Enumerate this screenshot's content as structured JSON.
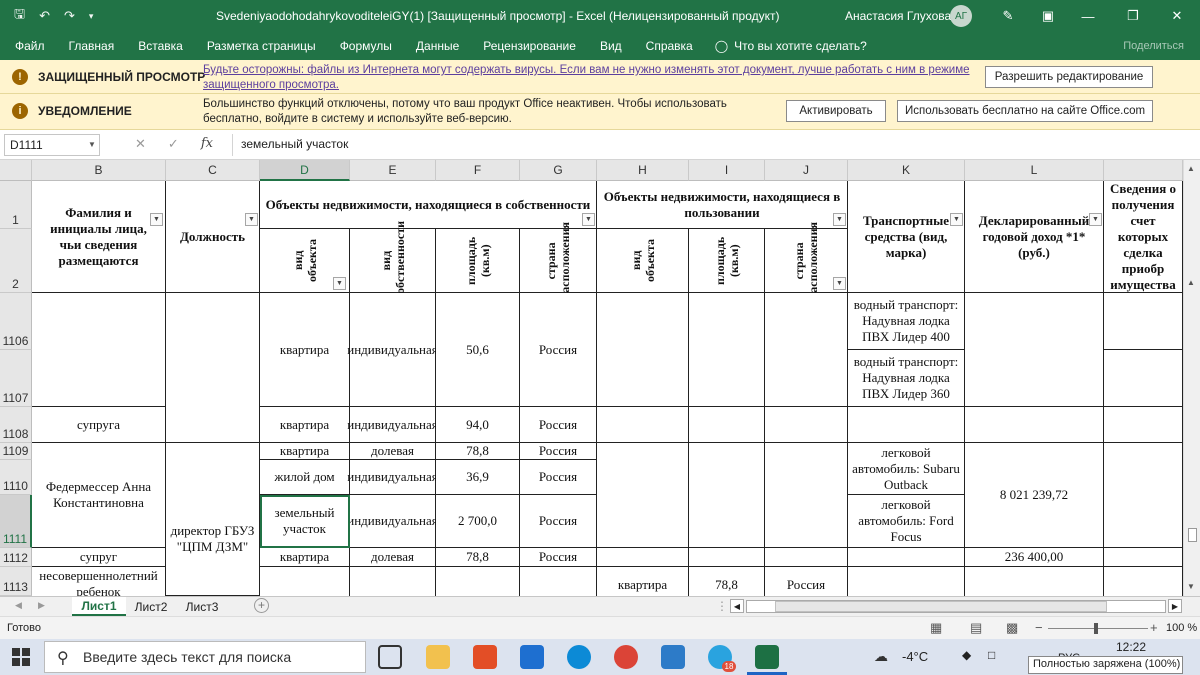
{
  "titlebar": {
    "doc_title": "SvedeniyaodohodahrykovoditeleiGY(1)  [Защищенный просмотр]  -  Excel (Нелицензированный продукт)",
    "user_name": "Анастасия Глухова",
    "avatar_initials": "АГ"
  },
  "ribbon": {
    "tabs": [
      "Файл",
      "Главная",
      "Вставка",
      "Разметка страницы",
      "Формулы",
      "Данные",
      "Рецензирование",
      "Вид",
      "Справка"
    ],
    "tell_me": "Что вы хотите сделать?",
    "share": "Поделиться"
  },
  "protected_bar": {
    "title": "ЗАЩИЩЕННЫЙ ПРОСМОТР",
    "text_line1": "Будьте осторожны: файлы из Интернета могут содержать вирусы. Если вам не нужно изменять этот документ, лучше работать с ним в режиме",
    "text_line2": "защищенного просмотра.",
    "button": "Разрешить редактирование"
  },
  "notice_bar": {
    "title": "УВЕДОМЛЕНИЕ",
    "text_line1": "Большинство функций отключены, потому что ваш продукт Office неактивен. Чтобы использовать",
    "text_line2": "бесплатно, войдите в систему и используйте веб-версию.",
    "button_activate": "Активировать",
    "button_online": "Использовать бесплатно на сайте Office.com"
  },
  "formula_bar": {
    "name_box": "D1111",
    "formula": "земельный участок"
  },
  "columns": [
    "B",
    "C",
    "D",
    "E",
    "F",
    "G",
    "H",
    "I",
    "J",
    "K",
    "L"
  ],
  "rows": [
    "1",
    "2",
    "1106",
    "1107",
    "1108",
    "1109",
    "1110",
    "1111",
    "1112",
    "1113"
  ],
  "header": {
    "fio": "Фамилия и инициалы лица, чьи сведения размещаются",
    "position": "Должность",
    "owned": "Объекты недвижимости, находящиеся в собственности",
    "used": "Объекты недвижимости, находящиеся в пользовании",
    "vehicles": "Транспортные средства (вид, марка)",
    "income": "Декларированный годовой доход *1* (руб.)",
    "sources": "Сведения о получения счет которых сделка приобр имущества",
    "obj_type": "вид объекта",
    "own_type": "вид собственности",
    "area": "площадь (кв.м)",
    "country": "страна расположения"
  },
  "cells": {
    "r1106_d": "квартира",
    "r1106_e": "индивидуальная",
    "r1106_f": "50,6",
    "r1106_g": "Россия",
    "r1106_k": "водный транспорт: Надувная лодка ПВХ Лидер 400",
    "r1107_k": "водный транспорт: Надувная лодка ПВХ Лидер 360",
    "r1108_b": "супруга",
    "r1108_d": "квартира",
    "r1108_e": "индивидуальная",
    "r1108_f": "94,0",
    "r1108_g": "Россия",
    "name_fed": "Федермессер Анна Константиновна",
    "position_fed": "директор ГБУЗ \"ЦПМ ДЗМ\"",
    "r1109_d": "квартира",
    "r1109_e": "долевая",
    "r1109_f": "78,8",
    "r1109_g": "Россия",
    "r1110_d": "жилой дом",
    "r1110_e": "индивидуальная",
    "r1110_f": "36,9",
    "r1110_g": "Россия",
    "r1111_d": "земельный участок",
    "r1111_e": "индивидуальная",
    "r1111_f": "2 700,0",
    "r1111_g": "Россия",
    "car1": "легковой автомобиль: Subaru Outback",
    "car2": "легковой автомобиль: Ford Focus",
    "income_fed": "8 021 239,72",
    "r1112_b": "супруг",
    "r1112_d": "квартира",
    "r1112_e": "долевая",
    "r1112_f": "78,8",
    "r1112_g": "Россия",
    "r1112_l": "236 400,00",
    "r1113_b": "несовершеннолетний ребенок",
    "r1113_h": "квартира",
    "r1113_i": "78,8",
    "r1113_j": "Россия"
  },
  "sheets": [
    "Лист1",
    "Лист2",
    "Лист3"
  ],
  "status": {
    "ready": "Готово",
    "zoom": "100 %"
  },
  "taskbar": {
    "search_placeholder": "Введите здесь текст для поиска",
    "temperature": "-4°C",
    "lang": "РУС",
    "time": "12:22",
    "battery_tooltip": "Полностью заряжена (100%)",
    "badge_count": "18"
  }
}
